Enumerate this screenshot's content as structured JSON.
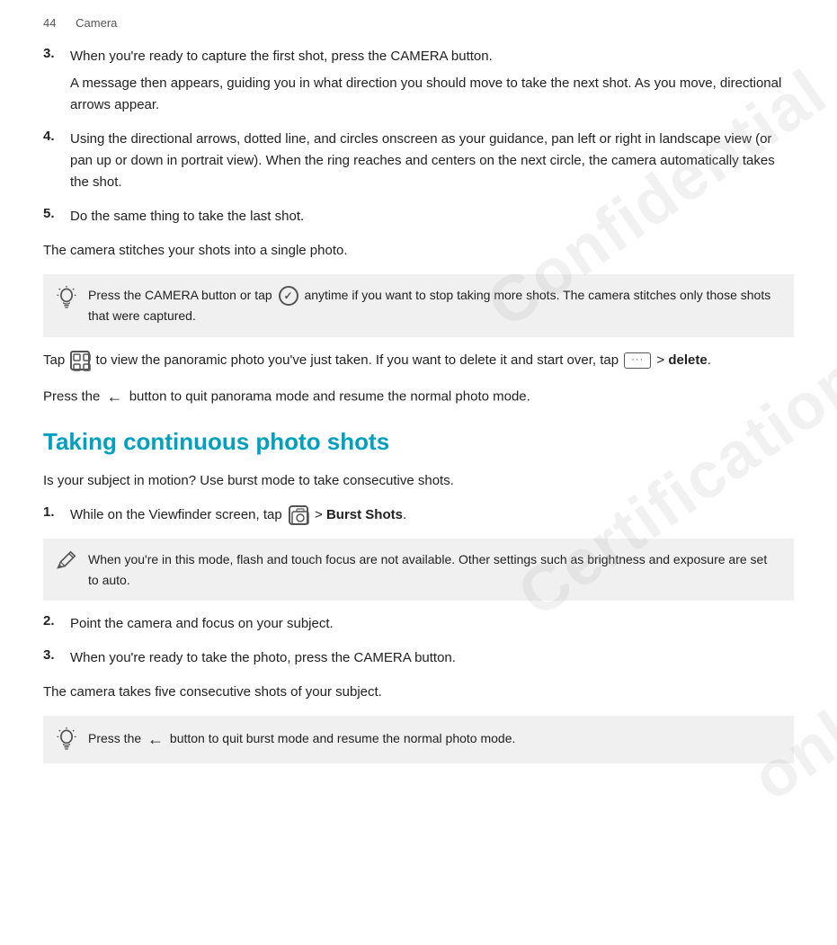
{
  "header": {
    "page_num": "44",
    "section": "Camera"
  },
  "watermarks": [
    "Confidential",
    "Certification",
    "only"
  ],
  "steps_section1": [
    {
      "num": "3.",
      "main": "When you're ready to capture the first shot, press the CAMERA button.",
      "sub": "A message then appears, guiding you in what direction you should move to take the next shot. As you move, directional arrows appear."
    },
    {
      "num": "4.",
      "main": "Using the directional arrows, dotted line, and circles onscreen as your guidance, pan left or right in landscape view (or pan up or down in portrait view). When the ring reaches and centers on the next circle, the camera automatically takes the shot."
    },
    {
      "num": "5.",
      "main": "Do the same thing to take the last shot."
    }
  ],
  "paragraph_stitch": "The camera stitches your shots into a single photo.",
  "tip1": {
    "text_before": "Press the CAMERA button or tap",
    "icon_desc": "checkmark-circle-icon",
    "text_after": "anytime if you want to stop taking more shots. The camera stitches only those shots that were captured."
  },
  "paragraph_tap": {
    "text1": "Tap",
    "icon1_desc": "grid-icon",
    "text2": "to view the panoramic photo you've just taken. If you want to delete it and start over, tap",
    "icon2_desc": "dots-menu-icon",
    "text3": "> ",
    "bold": "delete",
    "text4": "."
  },
  "paragraph_back": {
    "text1": "Press the",
    "icon_desc": "back-arrow-icon",
    "text2": "button to quit panorama mode and resume the normal photo mode."
  },
  "section_title": "Taking continuous photo shots",
  "paragraph_burst": "Is your subject in motion? Use burst mode to take consecutive shots.",
  "steps_section2": [
    {
      "num": "1.",
      "main_before": "While on the Viewfinder screen, tap",
      "icon_desc": "camera-settings-icon",
      "main_after": ">",
      "bold": "Burst Shots",
      "main_end": "."
    }
  ],
  "note1": {
    "text": "When you're in this mode, flash and touch focus are not available. Other settings such as brightness and exposure are set to auto."
  },
  "steps_section3": [
    {
      "num": "2.",
      "main": "Point the camera and focus on your subject."
    },
    {
      "num": "3.",
      "main": "When you're ready to take the photo, press the CAMERA button."
    }
  ],
  "paragraph_five": "The camera takes five consecutive shots of your subject.",
  "tip2": {
    "text1": "Press the",
    "icon_desc": "back-arrow-icon",
    "text2": "button to quit burst mode and resume the normal photo mode."
  },
  "icons": {
    "bulb": "💡",
    "pencil": "✏️",
    "back_arrow": "←",
    "check_circle": "✓",
    "dots": "···",
    "camera_cog": "⊙"
  }
}
